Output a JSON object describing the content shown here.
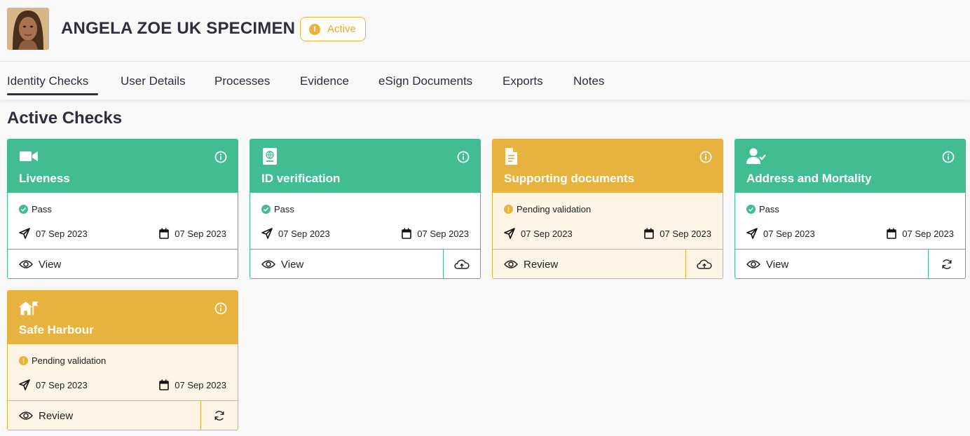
{
  "user": {
    "name": "ANGELA ZOE UK SPECIMEN",
    "status": "Active"
  },
  "tabs": [
    {
      "label": "Identity Checks",
      "active": true
    },
    {
      "label": "User Details"
    },
    {
      "label": "Processes"
    },
    {
      "label": "Evidence"
    },
    {
      "label": "eSign Documents"
    },
    {
      "label": "Exports"
    },
    {
      "label": "Notes"
    }
  ],
  "section": {
    "title": "Active Checks"
  },
  "colors": {
    "pass": "#41bd91",
    "pending": "#e8b23f",
    "pending_bg": "#fcf5e6",
    "text_dark": "#2e2e3e"
  },
  "checks": [
    {
      "title": "Liveness",
      "icon": "video-camera-icon",
      "status": "Pass",
      "sent": "07 Sep 2023",
      "date": "07 Sep 2023",
      "action": "View",
      "aux_icon": ""
    },
    {
      "title": "ID verification",
      "icon": "passport-icon",
      "status": "Pass",
      "sent": "07 Sep 2023",
      "date": "07 Sep 2023",
      "action": "View",
      "aux_icon": "cloud-upload-icon"
    },
    {
      "title": "Supporting documents",
      "icon": "document-icon",
      "status": "Pending validation",
      "sent": "07 Sep 2023",
      "date": "07 Sep 2023",
      "action": "Review",
      "aux_icon": "cloud-upload-icon"
    },
    {
      "title": "Address and Mortality",
      "icon": "user-check-icon",
      "status": "Pass",
      "sent": "07 Sep 2023",
      "date": "07 Sep 2023",
      "action": "View",
      "aux_icon": "refresh-icon"
    },
    {
      "title": "Safe Harbour",
      "icon": "house-flag-icon",
      "status": "Pending validation",
      "sent": "07 Sep 2023",
      "date": "07 Sep 2023",
      "action": "Review",
      "aux_icon": "refresh-icon"
    }
  ]
}
